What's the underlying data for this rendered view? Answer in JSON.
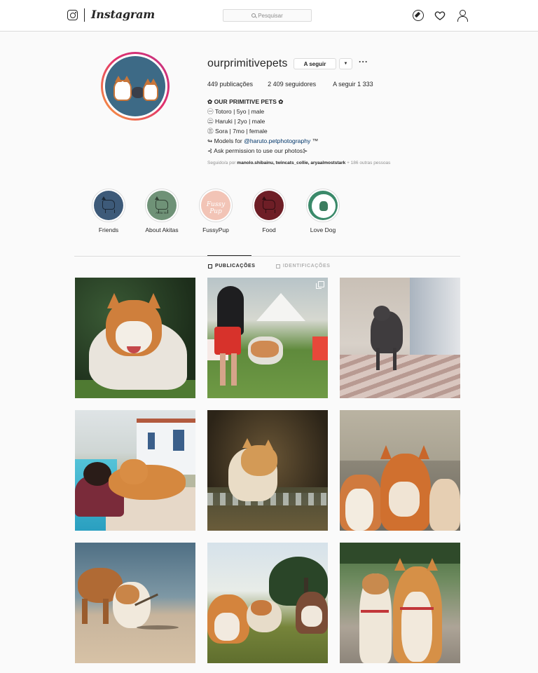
{
  "nav": {
    "brand": "Instagram",
    "search_placeholder": "Pesquisar",
    "icons": [
      "instagram-camera-icon",
      "compass-icon",
      "heart-icon",
      "user-icon"
    ]
  },
  "profile": {
    "username": "ourprimitivepets",
    "follow_label": "A seguir",
    "dropdown_glyph": "▼",
    "more_glyph": "···",
    "stats": {
      "posts": "449 publicações",
      "followers": "2 409 seguidores",
      "following": "A seguir 1 333"
    },
    "bio": {
      "name": "✿ OUR PRIMITIVE PETS ✿",
      "line1": "㊀ Totoro | 5yo | male",
      "line2": "㊁ Haruki | 2yo | male",
      "line3": "㊂ Sora | 7mo | female",
      "models_prefix": "↬ Models for ",
      "models_link": "@haruto.petphotography",
      "models_suffix": " ™",
      "line5": "⊰ Ask permission to use our photos⊱"
    },
    "followed_prefix": "Seguido/a por ",
    "followed_names": "manolo.shibainu, twincats_collie, aryaalmoststark",
    "followed_suffix": " + 186 outras pessoas"
  },
  "highlights": [
    {
      "label": "Friends",
      "color": "#3d5a79"
    },
    {
      "label": "About Akitas",
      "color": "#6f9277",
      "small": "Akita Inu"
    },
    {
      "label": "FussyPup",
      "color": "#f2c4b6",
      "script": "Fussy Pup"
    },
    {
      "label": "Food",
      "color": "#6e1e26"
    },
    {
      "label": "Love Dog",
      "color": "#3b8a6a"
    }
  ],
  "tabs": {
    "posts": "PUBLICAÇÕES",
    "tagged": "IDENTIFICAÇÕES"
  },
  "posts": [
    {
      "desc": "akita-portrait"
    },
    {
      "desc": "dog-show-handler"
    },
    {
      "desc": "grey-cat-walking"
    },
    {
      "desc": "woman-with-shiba-pool"
    },
    {
      "desc": "akita-in-water"
    },
    {
      "desc": "three-shibas"
    },
    {
      "desc": "dogs-at-beach-stick"
    },
    {
      "desc": "three-dogs-grass"
    },
    {
      "desc": "two-akitas-standing"
    }
  ]
}
